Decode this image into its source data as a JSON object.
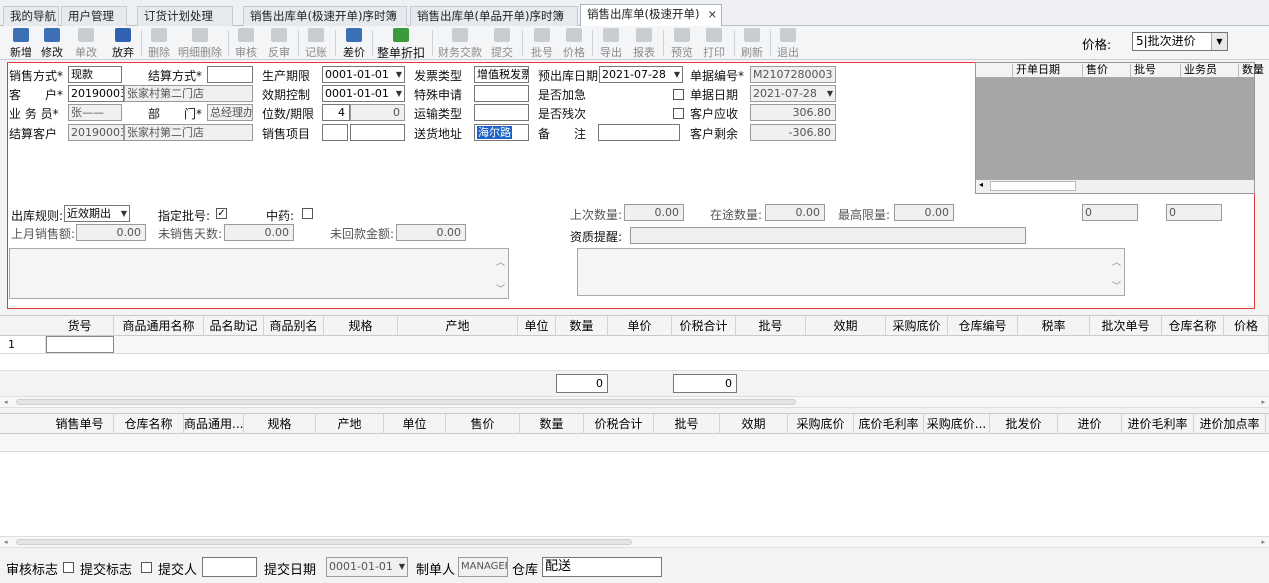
{
  "tabs": [
    {
      "label": "我的导航"
    },
    {
      "label": "用户管理"
    },
    {
      "label": "订货计划处理"
    },
    {
      "label": "销售出库单(极速开单)序时簿"
    },
    {
      "label": "销售出库单(单品开单)序时簿"
    },
    {
      "label": "销售出库单(极速开单)",
      "active": true,
      "close": "×"
    }
  ],
  "toolbar": {
    "buttons": [
      {
        "label": "新增",
        "icon": "new-doc-icon",
        "enabled": true
      },
      {
        "label": "修改",
        "icon": "edit-icon",
        "enabled": true
      },
      {
        "label": "单改",
        "icon": "single-edit-icon",
        "enabled": false
      },
      {
        "label": "放弃",
        "icon": "undo-icon",
        "enabled": true
      },
      {
        "label": "删除",
        "icon": "delete-icon",
        "enabled": false
      },
      {
        "label": "明细删除",
        "icon": "delete-detail-icon",
        "enabled": false
      },
      {
        "label": "审核",
        "icon": "audit-icon",
        "enabled": false
      },
      {
        "label": "反审",
        "icon": "unaudit-icon",
        "enabled": false
      },
      {
        "label": "记账",
        "icon": "ledger-icon",
        "enabled": false
      },
      {
        "label": "差价",
        "icon": "price-diff-icon",
        "enabled": true
      },
      {
        "label": "整单折扣",
        "icon": "discount-icon",
        "enabled": true
      },
      {
        "label": "财务交款",
        "icon": "finance-icon",
        "enabled": false
      },
      {
        "label": "提交",
        "icon": "submit-icon",
        "enabled": false
      },
      {
        "label": "批号",
        "icon": "batch-icon",
        "enabled": false
      },
      {
        "label": "价格",
        "icon": "price-icon",
        "enabled": false
      },
      {
        "label": "导出",
        "icon": "export-icon",
        "enabled": false
      },
      {
        "label": "报表",
        "icon": "report-icon",
        "enabled": false
      },
      {
        "label": "预览",
        "icon": "preview-icon",
        "enabled": false
      },
      {
        "label": "打印",
        "icon": "print-icon",
        "enabled": false
      },
      {
        "label": "刷新",
        "icon": "refresh-icon",
        "enabled": false
      },
      {
        "label": "退出",
        "icon": "exit-icon",
        "enabled": false
      }
    ],
    "price_label": "价格:",
    "price_value": "5|批次进价",
    "dropdown_arrow": "▼"
  },
  "form": {
    "sale_mode_label": "销售方式*",
    "sale_mode_value": "现款",
    "settle_mode_label": "结算方式*",
    "settle_mode_value": "",
    "prod_period_label": "生产期限",
    "prod_period_value": "0001-01-01",
    "invoice_type_label": "发票类型",
    "invoice_type_value": "增值税发票",
    "expected_date_label": "预出库日期",
    "expected_date_value": "2021-07-28",
    "doc_no_label": "单据编号*",
    "doc_no_value": "M2107280003",
    "customer_label": "客　　户*",
    "customer_code": "20190003",
    "customer_name": "张家村第二门店",
    "expiry_ctrl_label": "效期控制",
    "expiry_ctrl_value": "0001-01-01",
    "special_req_label": "特殊申请",
    "special_req_value": "",
    "urgent_label": "是否加急",
    "doc_date_label": "单据日期",
    "doc_date_value": "2021-07-28",
    "salesman_label": "业 务 员*",
    "salesman_value": "张——",
    "dept_label": "部　　门*",
    "dept_value": "总经理办",
    "digits_label": "位数/期限",
    "digits_value": "4",
    "period_value": "0",
    "transport_label": "运输类型",
    "transport_value": "",
    "residual_label": "是否残次",
    "receivable_label": "客户应收",
    "receivable_value": "306.80",
    "settle_cust_label": "结算客户",
    "settle_cust_code": "20190003",
    "settle_cust_name": "张家村第二门店",
    "sales_item_label": "销售项目",
    "address_label": "送货地址",
    "address_value": "海尔路",
    "remark_label": "备　　注",
    "remark_value": "",
    "balance_label": "客户剩余",
    "balance_value": "-306.80",
    "out_rule_label": "出库规则:",
    "out_rule_value": "近效期出",
    "assign_batch_label": "指定批号:",
    "assign_batch_mark": "✓",
    "tcm_label": "中药:",
    "last_month_label": "上月销售额:",
    "last_month_value": "0.00",
    "unsold_days_label": "未销售天数:",
    "unsold_days_value": "0.00",
    "unpaid_label": "未回款金额:",
    "unpaid_value": "0.00",
    "last_qty_label": "上次数量:",
    "last_qty_value": "0.00",
    "transit_qty_label": "在途数量:",
    "transit_qty_value": "0.00",
    "max_limit_label": "最高限量:",
    "max_limit_value": "0.00",
    "field_a_value": "0",
    "field_b_value": "0",
    "quality_label": "资质提醒:",
    "quality_value": ""
  },
  "side_grid": {
    "columns": [
      "开单日期",
      "售价",
      "批号",
      "业务员",
      "数量"
    ]
  },
  "detail_grid": {
    "columns": [
      "货号",
      "商品通用名称",
      "品名助记",
      "商品别名",
      "规格",
      "产地",
      "单位",
      "数量",
      "单价",
      "价税合计",
      "批号",
      "效期",
      "采购底价",
      "仓库编号",
      "税率",
      "批次单号",
      "仓库名称",
      "价格"
    ],
    "row_number": "1",
    "sum_qty": "0",
    "sum_total": "0"
  },
  "history_grid": {
    "columns": [
      "销售单号",
      "仓库名称",
      "商品通用...",
      "规格",
      "产地",
      "单位",
      "售价",
      "数量",
      "价税合计",
      "批号",
      "效期",
      "采购底价",
      "底价毛利率",
      "采购底价...",
      "批发价",
      "进价",
      "进价毛利率",
      "进价加点率"
    ]
  },
  "footer": {
    "audit_flag_label": "审核标志",
    "submit_flag_label": "提交标志",
    "submitter_label": "提交人",
    "submitter_value": "",
    "submit_date_label": "提交日期",
    "submit_date_value": "0001-01-01",
    "maker_label": "制单人",
    "maker_value": "MANAGER",
    "warehouse_label": "仓库",
    "warehouse_value": "配送"
  }
}
